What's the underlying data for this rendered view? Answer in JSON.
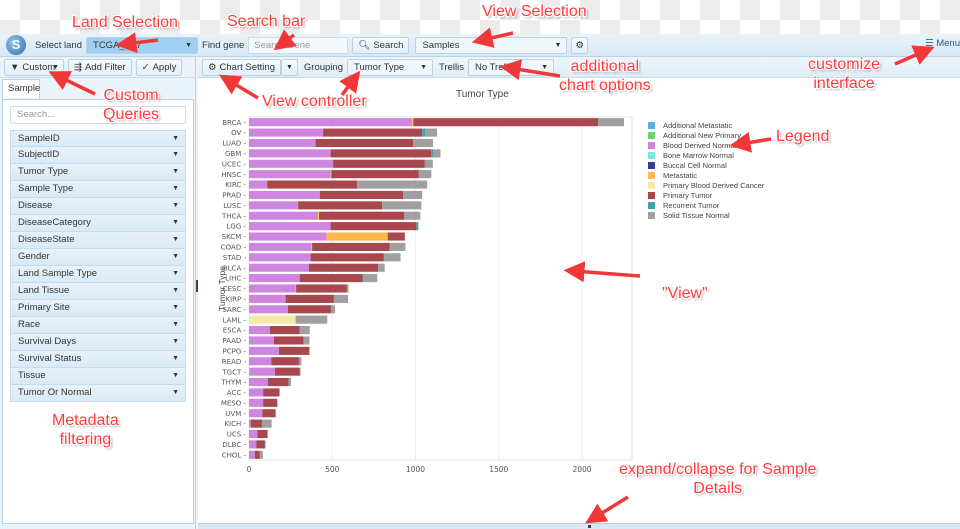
{
  "topbar": {
    "select_land_label": "Select land",
    "land_value": "TCGA_B37",
    "find_gene_label": "Find gene",
    "search_gene_placeholder": "Search Gene",
    "search_button": "Search",
    "view_value": "Samples",
    "menu_label": "Menu"
  },
  "left": {
    "custom_label": "Custom",
    "add_filter_label": "Add Filter",
    "apply_label": "Apply",
    "tab_label": "Sample",
    "search_placeholder": "Search...",
    "facets": [
      "SampleID",
      "SubjectID",
      "Tumor Type",
      "Sample Type",
      "Disease",
      "DiseaseCategory",
      "DiseaseState",
      "Gender",
      "Land Sample Type",
      "Land Tissue",
      "Primary Site",
      "Race",
      "Survival Days",
      "Survival Status",
      "Tissue",
      "Tumor Or Normal"
    ]
  },
  "main_toolbar": {
    "chart_setting_label": "Chart Setting",
    "grouping_label": "Grouping",
    "grouping_value": "Tumor Type",
    "trellis_label": "Trellis",
    "trellis_value": "No Trellis"
  },
  "annotations": {
    "land_selection": "Land Selection",
    "search_bar": "Search bar",
    "view_selection": "View Selection",
    "customize_interface": "customize\ninterface",
    "custom_queries": "Custom\nQueries",
    "view_controller": "View controller",
    "additional_chart_options": "additional\nchart options",
    "legend": "Legend",
    "view": "\"View\"",
    "metadata_filtering": "Metadata\nfiltering",
    "expand_collapse": "expand/collapse for Sample\nDetails"
  },
  "chart_data": {
    "type": "bar",
    "orientation": "horizontal",
    "stacked": true,
    "title": "Tumor Type",
    "xlabel": "",
    "ylabel": "Tumor Type",
    "xlim": [
      0,
      2300
    ],
    "xticks": [
      0,
      500,
      1000,
      1500,
      2000
    ],
    "grid": true,
    "legend_position": "right",
    "categories": [
      "BRCA",
      "OV",
      "LUAD",
      "GBM",
      "UCEC",
      "HNSC",
      "KIRC",
      "PRAD",
      "LUSC",
      "THCA",
      "LGG",
      "SKCM",
      "COAD",
      "STAD",
      "BLCA",
      "LIHC",
      "CESC",
      "KIRP",
      "SARC",
      "LAML",
      "ESCA",
      "PAAD",
      "PCPG",
      "READ",
      "TGCT",
      "THYM",
      "ACC",
      "MESO",
      "UVM",
      "KICH",
      "UCS",
      "DLBC",
      "CHOL"
    ],
    "series": [
      {
        "name": "Additional Metastatic",
        "color": "#5dade2",
        "values": [
          0,
          0,
          0,
          0,
          0,
          0,
          0,
          0,
          0,
          0,
          0,
          3,
          0,
          0,
          0,
          0,
          0,
          0,
          0,
          0,
          0,
          0,
          0,
          0,
          0,
          0,
          0,
          0,
          0,
          0,
          0,
          0,
          0
        ]
      },
      {
        "name": "Additional New Primary",
        "color": "#6fd46f",
        "values": [
          0,
          0,
          0,
          0,
          0,
          0,
          0,
          0,
          0,
          0,
          0,
          0,
          0,
          0,
          0,
          0,
          0,
          0,
          0,
          0,
          0,
          0,
          0,
          0,
          5,
          0,
          0,
          0,
          0,
          0,
          0,
          0,
          0
        ]
      },
      {
        "name": "Blood Derived Normal",
        "color": "#cf86e0",
        "values": [
          980,
          445,
          400,
          490,
          505,
          490,
          110,
          425,
          295,
          415,
          490,
          462,
          375,
          370,
          360,
          305,
          280,
          220,
          230,
          0,
          125,
          145,
          180,
          135,
          150,
          115,
          85,
          85,
          80,
          10,
          50,
          45,
          35
        ]
      },
      {
        "name": "Bone Marrow Normal",
        "color": "#7fe5e0",
        "values": [
          0,
          0,
          0,
          0,
          0,
          0,
          0,
          0,
          0,
          0,
          0,
          0,
          0,
          0,
          0,
          0,
          0,
          0,
          0,
          0,
          0,
          0,
          0,
          0,
          0,
          0,
          0,
          0,
          0,
          0,
          0,
          0,
          0
        ]
      },
      {
        "name": "Buccal Cell Normal",
        "color": "#3b3b98",
        "values": [
          0,
          0,
          0,
          0,
          0,
          0,
          0,
          0,
          0,
          0,
          0,
          0,
          0,
          0,
          0,
          2,
          0,
          0,
          0,
          0,
          0,
          0,
          0,
          0,
          0,
          2,
          0,
          0,
          0,
          0,
          0,
          0,
          0
        ]
      },
      {
        "name": "Metastatic",
        "color": "#ffb84a",
        "values": [
          7,
          0,
          0,
          0,
          0,
          5,
          0,
          0,
          0,
          6,
          0,
          368,
          4,
          0,
          0,
          0,
          3,
          0,
          2,
          0,
          0,
          3,
          0,
          0,
          0,
          0,
          0,
          0,
          0,
          0,
          0,
          0,
          0
        ]
      },
      {
        "name": "Primary Blood Derived Cancer",
        "color": "#f5e8a8",
        "values": [
          0,
          0,
          0,
          0,
          0,
          0,
          0,
          0,
          0,
          0,
          0,
          0,
          0,
          0,
          0,
          0,
          0,
          0,
          0,
          280,
          0,
          0,
          0,
          0,
          0,
          0,
          0,
          0,
          0,
          0,
          0,
          0,
          0
        ]
      },
      {
        "name": "Primary Tumor",
        "color": "#a8474d",
        "values": [
          1110,
          595,
          585,
          605,
          550,
          525,
          540,
          500,
          505,
          510,
          515,
          103,
          465,
          440,
          415,
          375,
          305,
          290,
          260,
          0,
          180,
          180,
          180,
          165,
          150,
          120,
          95,
          85,
          80,
          68,
          60,
          48,
          30
        ]
      },
      {
        "name": "Recurrent Tumor",
        "color": "#3fa0a8",
        "values": [
          0,
          17,
          0,
          10,
          5,
          0,
          0,
          0,
          0,
          0,
          12,
          0,
          0,
          0,
          0,
          3,
          0,
          0,
          5,
          0,
          0,
          0,
          0,
          5,
          0,
          0,
          0,
          0,
          0,
          0,
          0,
          6,
          0
        ]
      },
      {
        "name": "Solid Tissue Normal",
        "color": "#a0a0a0",
        "values": [
          155,
          72,
          120,
          45,
          44,
          75,
          420,
          115,
          235,
          98,
          0,
          0,
          95,
          100,
          40,
          85,
          10,
          85,
          20,
          190,
          60,
          35,
          5,
          10,
          5,
          15,
          5,
          0,
          0,
          58,
          4,
          0,
          18
        ]
      }
    ]
  }
}
